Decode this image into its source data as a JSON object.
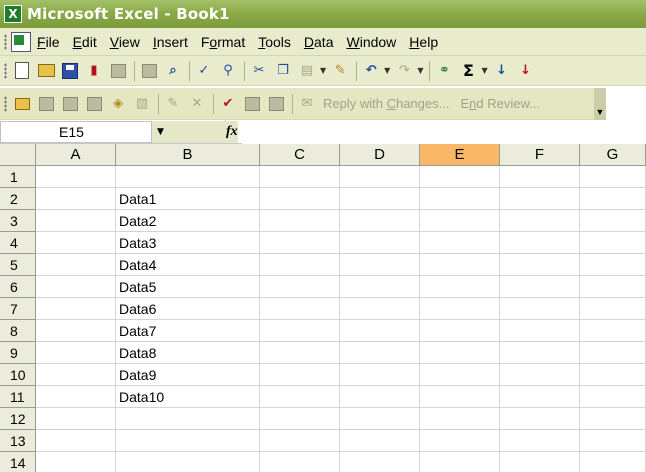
{
  "window": {
    "title": "Microsoft Excel - Book1",
    "app_icon_glyph": "X"
  },
  "menu": {
    "items": [
      {
        "pre": "",
        "key": "F",
        "post": "ile"
      },
      {
        "pre": "",
        "key": "E",
        "post": "dit"
      },
      {
        "pre": "",
        "key": "V",
        "post": "iew"
      },
      {
        "pre": "",
        "key": "I",
        "post": "nsert"
      },
      {
        "pre": "F",
        "key": "o",
        "post": "rmat"
      },
      {
        "pre": "",
        "key": "T",
        "post": "ools"
      },
      {
        "pre": "",
        "key": "D",
        "post": "ata"
      },
      {
        "pre": "",
        "key": "W",
        "post": "indow"
      },
      {
        "pre": "",
        "key": "H",
        "post": "elp"
      }
    ]
  },
  "toolbar2": {
    "reply_pre": "Reply with ",
    "reply_key": "C",
    "reply_post": "hanges...",
    "end_pre": "E",
    "end_key": "n",
    "end_post": "d Review..."
  },
  "formula_bar": {
    "name_box": "E15",
    "fx_label": "fx",
    "formula": ""
  },
  "sheet": {
    "columns": [
      "A",
      "B",
      "C",
      "D",
      "E",
      "F",
      "G"
    ],
    "selected_column": "E",
    "rows": [
      {
        "num": "1",
        "b": ""
      },
      {
        "num": "2",
        "b": "Data1"
      },
      {
        "num": "3",
        "b": "Data2"
      },
      {
        "num": "4",
        "b": "Data3"
      },
      {
        "num": "5",
        "b": "Data4"
      },
      {
        "num": "6",
        "b": "Data5"
      },
      {
        "num": "7",
        "b": "Data6"
      },
      {
        "num": "8",
        "b": "Data7"
      },
      {
        "num": "9",
        "b": "Data8"
      },
      {
        "num": "10",
        "b": "Data9"
      },
      {
        "num": "11",
        "b": "Data10"
      },
      {
        "num": "12",
        "b": ""
      },
      {
        "num": "13",
        "b": ""
      },
      {
        "num": "14",
        "b": ""
      }
    ]
  },
  "colors": {
    "title_bar": "#8aab47",
    "command_bar": "#e8ebcc",
    "selected_header": "#f9b868"
  }
}
